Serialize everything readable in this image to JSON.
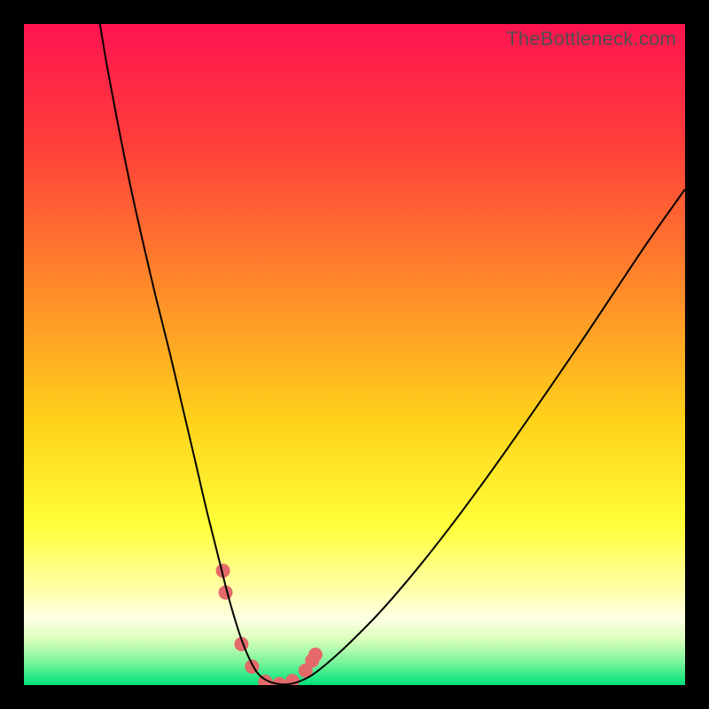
{
  "watermark": "TheBottleneck.com",
  "chart_data": {
    "type": "line",
    "title": "",
    "xlabel": "",
    "ylabel": "",
    "xlim": [
      0,
      100
    ],
    "ylim": [
      0,
      100
    ],
    "gradient_stops": [
      {
        "offset": 0,
        "color": "#ff1450"
      },
      {
        "offset": 18,
        "color": "#ff3e3a"
      },
      {
        "offset": 40,
        "color": "#ff8a2a"
      },
      {
        "offset": 60,
        "color": "#ffd21a"
      },
      {
        "offset": 76,
        "color": "#ffff3a"
      },
      {
        "offset": 86,
        "color": "#ffffaf"
      },
      {
        "offset": 90,
        "color": "#ffffe4"
      },
      {
        "offset": 93,
        "color": "#dcffbc"
      },
      {
        "offset": 96.5,
        "color": "#7cf59b"
      },
      {
        "offset": 100,
        "color": "#00e27a"
      }
    ],
    "series": [
      {
        "name": "curve",
        "x": [
          11.5,
          12.5,
          14,
          16,
          18,
          20,
          22,
          24,
          26,
          27.5,
          29,
          30.5,
          31.6,
          32.8,
          34,
          35.2,
          36.4,
          37.8,
          39.4,
          41.2,
          43.4,
          46,
          49.5,
          54,
          59,
          64,
          69,
          74,
          79,
          84,
          89,
          94,
          98,
          100
        ],
        "y": [
          100,
          94,
          86,
          76,
          67,
          58.5,
          50.5,
          42,
          33.5,
          27,
          21,
          15,
          11,
          7.2,
          4.2,
          2,
          0.9,
          0.3,
          0.1,
          0.4,
          1.4,
          3.4,
          6.6,
          11.2,
          17,
          23.3,
          30,
          37,
          44.2,
          51.5,
          59,
          66.5,
          72.2,
          75
        ]
      }
    ],
    "markers": {
      "name": "highlight-dots",
      "x": [
        30.1,
        30.5,
        32.9,
        34.5,
        36.5,
        38.6,
        40.6,
        42.6,
        43.6,
        44.1
      ],
      "y": [
        17.3,
        14.0,
        6.2,
        2.8,
        0.5,
        0.15,
        0.6,
        2.2,
        3.7,
        4.6
      ],
      "color": "#e46a6a",
      "radius": 8
    }
  }
}
